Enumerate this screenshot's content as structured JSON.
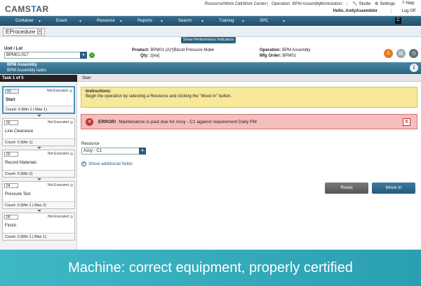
{
  "header": {
    "logo": "CAMSTAR",
    "resource_label": "Resource/Work Cell:",
    "work_center_label": "Work Center:",
    "operation_label": "Operation: BPM Assembly",
    "workstation_label": "Workstation:",
    "studio": "Studio",
    "settings": "Settings",
    "help": "Help",
    "hello": "Hello, AndyAssembler",
    "logoff": "Log Off"
  },
  "nav": {
    "items": [
      "Container",
      "Event",
      "Resource",
      "Reports",
      "Search",
      "Training",
      "SPC"
    ],
    "corner": "C"
  },
  "tab": {
    "title": "EProcedure",
    "perf_button": "Show Performance Indicators"
  },
  "unit": {
    "label": "Unit / Lot",
    "value": "BPM01-017",
    "product_label": "Product:",
    "product_value": "BPM01 (A)*[Blood Pressure Mo...",
    "qty_label": "Qty:",
    "qty_value": "1[ea]",
    "operation_label": "Operation:",
    "operation_value": "BPM Assembly",
    "mfg_label": "Mfg Order:",
    "mfg_value": "BPM01"
  },
  "section": {
    "title": "BPM Assembly",
    "subtitle": "BPM Assembly tasks"
  },
  "tasks": {
    "header": "Task 1 of 5",
    "items": [
      {
        "num": "01",
        "status": "Not Executed",
        "name": "Start",
        "count": "Count: 0 (Min 1 | Max 1)"
      },
      {
        "num": "02",
        "status": "Not Executed",
        "name": "Line Clearance",
        "count": "Count: 0 (Min 1)"
      },
      {
        "num": "03",
        "status": "Not Executed",
        "name": "Record Materials",
        "count": "Count: 0 (Min 2)"
      },
      {
        "num": "04",
        "status": "Not Executed",
        "name": "Pressure Test",
        "count": "Count: 0 (Min 1 | Max 2)"
      },
      {
        "num": "05",
        "status": "Not Executed",
        "name": "Finish",
        "count": "Count: 0 (Min 1 | Max 1)"
      }
    ]
  },
  "main": {
    "header": "Start",
    "instructions_title": "Instructions:",
    "instructions_text": "Begin the operation by selecting a Resource and clicking the \"Move In\" button.",
    "error_label": "ERROR!",
    "error_text": "Maintenance is past due for Assy - C1 against requirement Daily PM",
    "resource_label": "Resource",
    "resource_value": "Assy - C1",
    "additional_fields": "Show additional fields",
    "reset": "Reset",
    "move_in": "Move In"
  },
  "caption": "Machine: correct equipment, properly certified"
}
